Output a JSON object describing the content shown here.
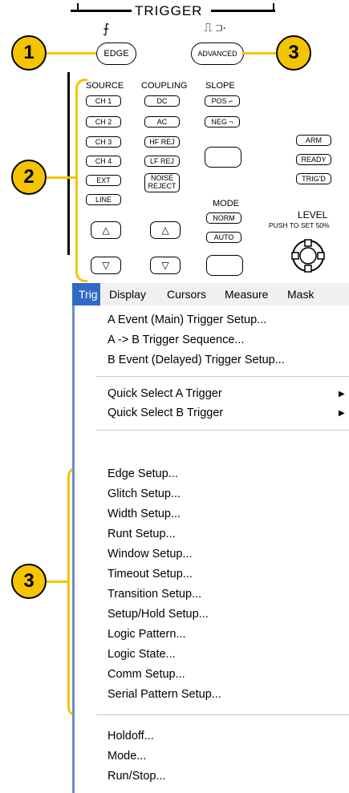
{
  "trigger_panel": {
    "title": "TRIGGER",
    "edge_label": "EDGE",
    "advanced_label": "ADVANCED",
    "col_source": "SOURCE",
    "col_coupling": "COUPLING",
    "col_slope": "SLOPE",
    "source_buttons": [
      "CH 1",
      "CH 2",
      "CH 3",
      "CH 4",
      "EXT",
      "LINE"
    ],
    "coupling_buttons": [
      "DC",
      "AC",
      "HF REJ",
      "LF REJ"
    ],
    "noise_reject_line1": "NOISE",
    "noise_reject_line2": "REJECT",
    "slope_pos": "POS",
    "slope_neg": "NEG",
    "status_buttons": [
      "ARM",
      "READY",
      "TRIG'D"
    ],
    "mode_label": "MODE",
    "mode_norm": "NORM",
    "mode_auto": "AUTO",
    "level_label": "LEVEL",
    "level_sub": "PUSH TO SET 50%"
  },
  "callouts": {
    "c1": "1",
    "c2": "2",
    "c3_top": "3",
    "c3_bottom": "3"
  },
  "colors": {
    "callout": "#f5c400",
    "menu_highlight": "#316ac5"
  },
  "menu": {
    "bar": [
      "Trig",
      "Display",
      "Cursors",
      "Measure",
      "Mask"
    ],
    "group1": [
      "A Event (Main) Trigger Setup...",
      "A -> B Trigger Sequence...",
      "B Event (Delayed) Trigger Setup..."
    ],
    "group2": [
      "Quick Select A Trigger",
      "Quick Select B Trigger"
    ],
    "group3": [
      "Edge Setup...",
      "Glitch Setup...",
      "Width Setup...",
      "Runt Setup...",
      "Window Setup...",
      "Timeout Setup...",
      "Transition Setup...",
      "Setup/Hold Setup...",
      "Logic Pattern...",
      "Logic State...",
      "Comm Setup...",
      "Serial Pattern Setup..."
    ],
    "group4": [
      "Holdoff...",
      "Mode...",
      "Run/Stop..."
    ]
  }
}
